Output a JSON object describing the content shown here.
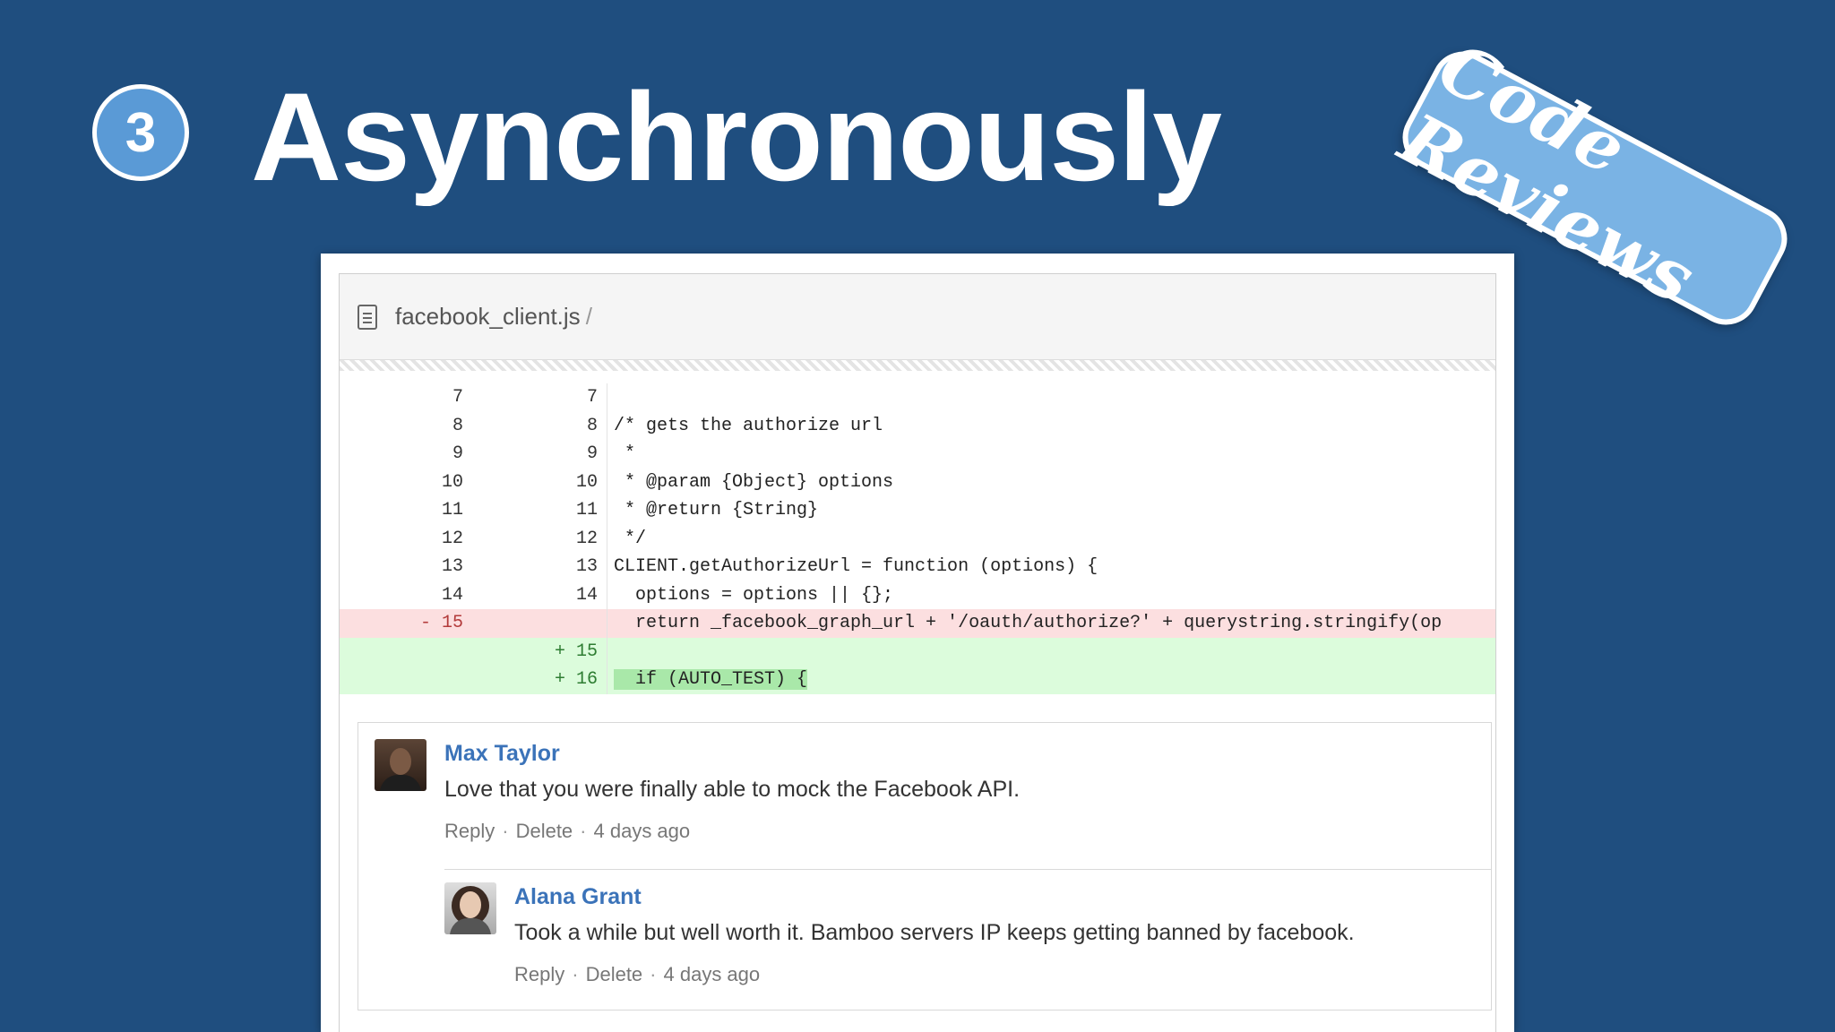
{
  "slide": {
    "step_number": "3",
    "headline": "Asynchronously",
    "stamp_text": "Code Reviews"
  },
  "file": {
    "name": "facebook_client.js",
    "separator": "/"
  },
  "diff": [
    {
      "type": "context",
      "old": "7",
      "new": "7",
      "code": ""
    },
    {
      "type": "context",
      "old": "8",
      "new": "8",
      "code": "/* gets the authorize url"
    },
    {
      "type": "context",
      "old": "9",
      "new": "9",
      "code": " *"
    },
    {
      "type": "context",
      "old": "10",
      "new": "10",
      "code": " * @param {Object} options"
    },
    {
      "type": "context",
      "old": "11",
      "new": "11",
      "code": " * @return {String}"
    },
    {
      "type": "context",
      "old": "12",
      "new": "12",
      "code": " */"
    },
    {
      "type": "context",
      "old": "13",
      "new": "13",
      "code": "CLIENT.getAuthorizeUrl = function (options) {"
    },
    {
      "type": "context",
      "old": "14",
      "new": "14",
      "code": "  options = options || {};"
    },
    {
      "type": "del",
      "old": "- 15",
      "new": "",
      "code": "  return _facebook_graph_url + '/oauth/authorize?' + querystring.stringify(op"
    },
    {
      "type": "add",
      "old": "",
      "new": "+ 15",
      "code": "  "
    },
    {
      "type": "add",
      "old": "",
      "new": "+ 16",
      "code": "  if (AUTO_TEST) {"
    }
  ],
  "comments": [
    {
      "author": "Max Taylor",
      "text": "Love that you were finally able to mock the Facebook API.",
      "actions": {
        "reply": "Reply",
        "delete": "Delete",
        "time": "4 days ago"
      }
    },
    {
      "author": "Alana Grant",
      "text": "Took a while but well worth it. Bamboo servers IP keeps getting banned by facebook.",
      "actions": {
        "reply": "Reply",
        "delete": "Delete",
        "time": "4 days ago"
      }
    }
  ],
  "colors": {
    "background": "#1f4e7f",
    "accent": "#5a9ad6",
    "author_link": "#3b73b9",
    "deleted_row": "#fcdfe0",
    "added_row": "#dcfcdc"
  }
}
